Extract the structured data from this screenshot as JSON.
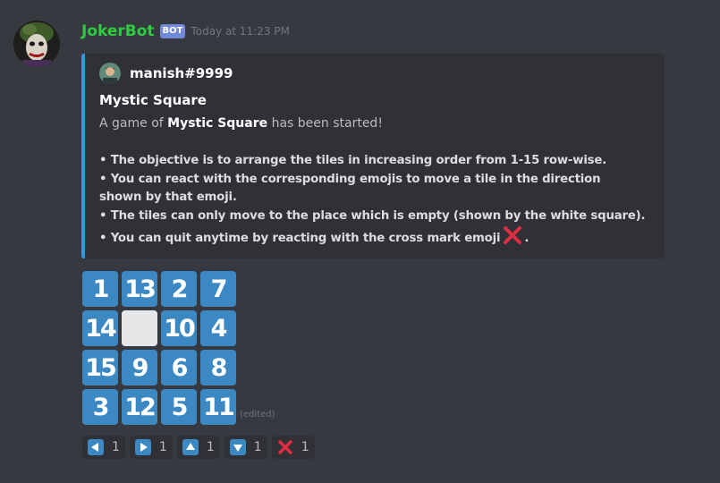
{
  "message": {
    "username": "JokerBot",
    "bot_tag": "BOT",
    "timestamp": "Today at 11:23 PM"
  },
  "embed": {
    "author": "manish#9999",
    "title": "Mystic Square",
    "description": {
      "prefix": "A game of ",
      "bold": "Mystic Square",
      "suffix": " has been started!"
    },
    "rules": [
      "• The objective is to arrange the tiles in increasing order from 1-15 row-wise.",
      "• You can react with the corresponding emojis to move a tile in the direction",
      "shown by that emoji.",
      "• The tiles can only move to the place which is empty (shown by the white square).",
      "• You can quit anytime by reacting with the cross mark emoji",
      "."
    ],
    "accent_color": "#3498db"
  },
  "board": {
    "rows": [
      [
        "1",
        "13",
        "2",
        "7"
      ],
      [
        "14",
        "",
        "10",
        "4"
      ],
      [
        "15",
        "9",
        "6",
        "8"
      ],
      [
        "3",
        "12",
        "5",
        "11"
      ]
    ],
    "tile_color": "#3b88c3",
    "empty_color": "#e6e7e8"
  },
  "edited_label": "(edited)",
  "reactions": [
    {
      "icon": "left-arrow-icon",
      "count": "1"
    },
    {
      "icon": "right-arrow-icon",
      "count": "1"
    },
    {
      "icon": "up-arrow-icon",
      "count": "1"
    },
    {
      "icon": "down-arrow-icon",
      "count": "1"
    },
    {
      "icon": "cross-mark-icon",
      "count": "1"
    }
  ],
  "colors": {
    "background": "#36393f",
    "embed_background": "#2f3136",
    "username": "#2ecc40",
    "bot_tag": "#7289da",
    "cross": "#dd2e44"
  }
}
